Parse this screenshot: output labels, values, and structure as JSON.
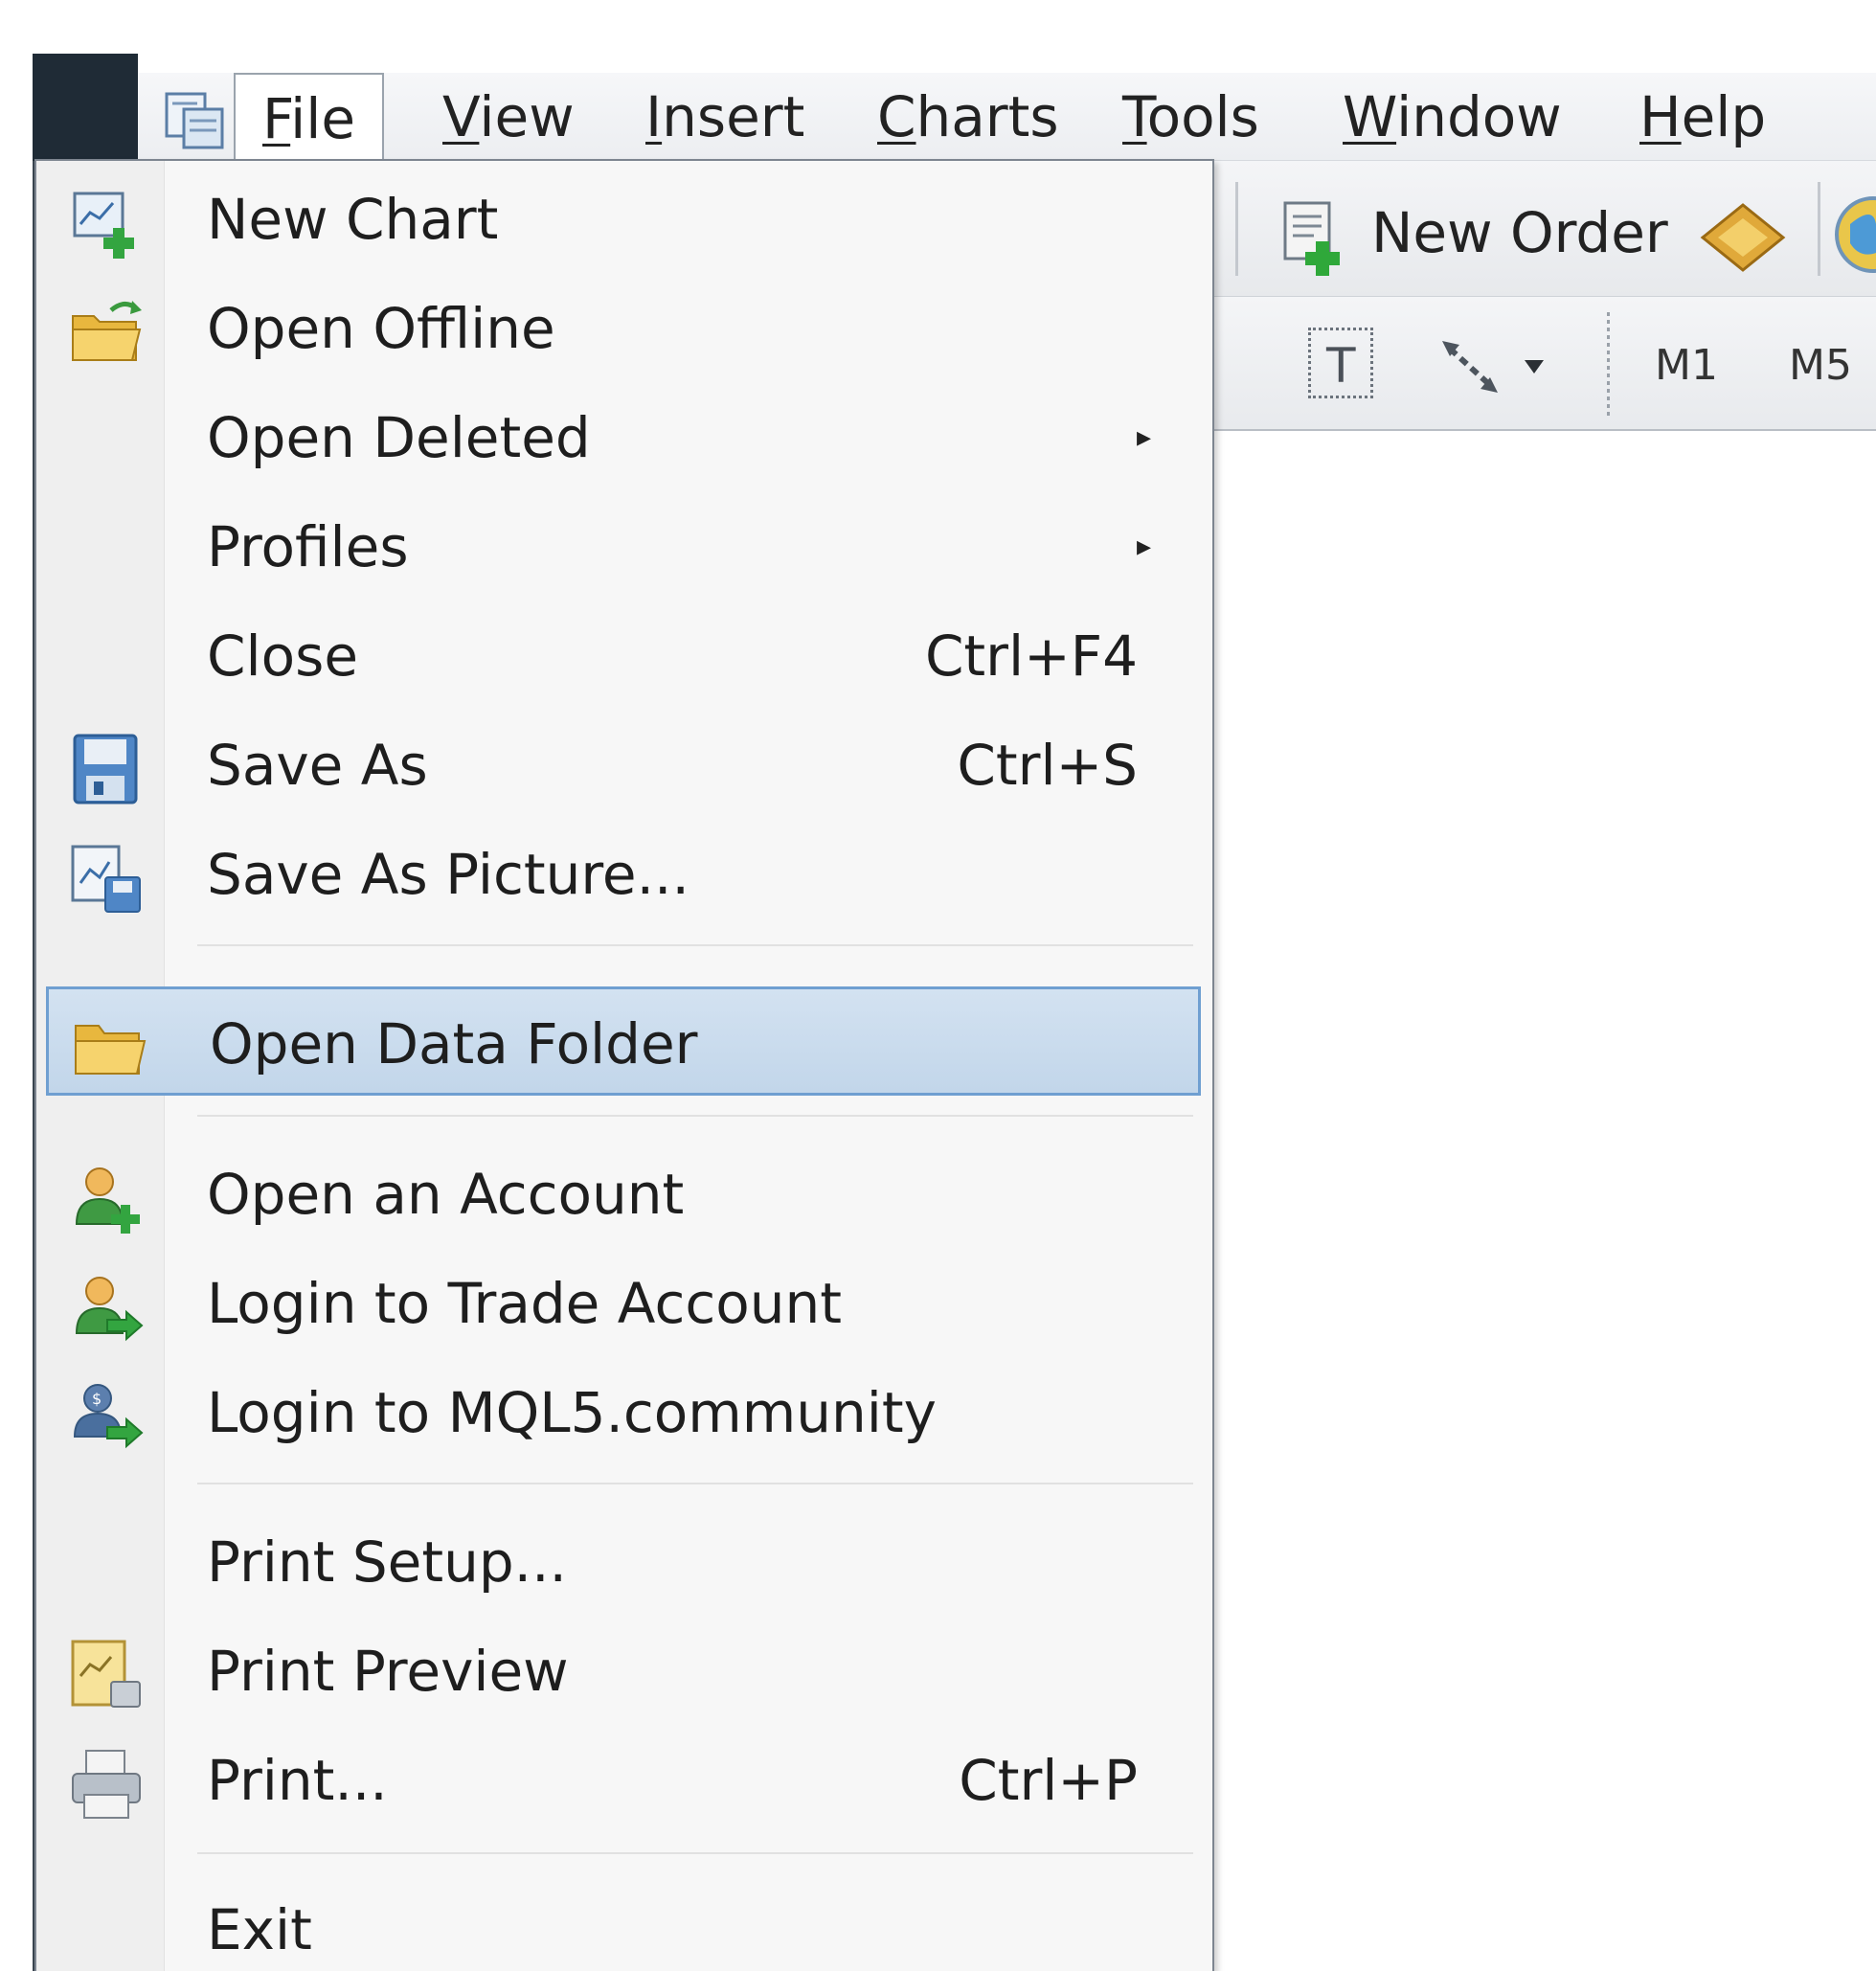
{
  "menubar": {
    "items": [
      {
        "label": "File",
        "accel": "F",
        "rest": "ile"
      },
      {
        "label": "View",
        "accel": "V",
        "rest": "iew"
      },
      {
        "label": "Insert",
        "accel": "I",
        "rest": "nsert"
      },
      {
        "label": "Charts",
        "accel": "C",
        "rest": "harts"
      },
      {
        "label": "Tools",
        "accel": "T",
        "rest": "ools"
      },
      {
        "label": "Window",
        "accel": "W",
        "rest": "indow"
      },
      {
        "label": "Help",
        "accel": "H",
        "rest": "elp"
      }
    ],
    "active": "File"
  },
  "toolbar": {
    "new_order_label": "New Order",
    "text_tool": "T",
    "timeframes": [
      "M1",
      "M5"
    ]
  },
  "file_menu": {
    "items": [
      {
        "label": "New Chart",
        "icon": "new-chart-icon",
        "shortcut": ""
      },
      {
        "label": "Open Offline",
        "icon": "open-offline-folder-icon",
        "shortcut": ""
      },
      {
        "label": "Open Deleted",
        "icon": "",
        "shortcut": "",
        "submenu": true
      },
      {
        "label": "Profiles",
        "icon": "",
        "shortcut": "",
        "submenu": true
      },
      {
        "label": "Close",
        "icon": "",
        "shortcut": "Ctrl+F4"
      },
      {
        "label": "Save As",
        "icon": "floppy-disk-icon",
        "shortcut": "Ctrl+S"
      },
      {
        "label": "Save As Picture...",
        "icon": "save-picture-icon",
        "shortcut": ""
      },
      {
        "label": "Open Data Folder",
        "icon": "folder-icon",
        "shortcut": "",
        "highlighted": true
      },
      {
        "label": "Open an Account",
        "icon": "user-add-icon",
        "shortcut": ""
      },
      {
        "label": "Login to Trade Account",
        "icon": "user-login-icon",
        "shortcut": ""
      },
      {
        "label": "Login to MQL5.community",
        "icon": "mql5-login-icon",
        "shortcut": ""
      },
      {
        "label": "Print Setup...",
        "icon": "",
        "shortcut": ""
      },
      {
        "label": "Print Preview",
        "icon": "print-preview-icon",
        "shortcut": ""
      },
      {
        "label": "Print...",
        "icon": "printer-icon",
        "shortcut": "Ctrl+P"
      },
      {
        "label": "Exit",
        "icon": "",
        "shortcut": ""
      }
    ],
    "submenu_arrow": "▸"
  },
  "colors": {
    "highlight_fill": "#c9dbee",
    "highlight_border": "#6f9fd1",
    "menu_bg": "#f7f7f7",
    "frame_dark": "#1f2b36"
  }
}
